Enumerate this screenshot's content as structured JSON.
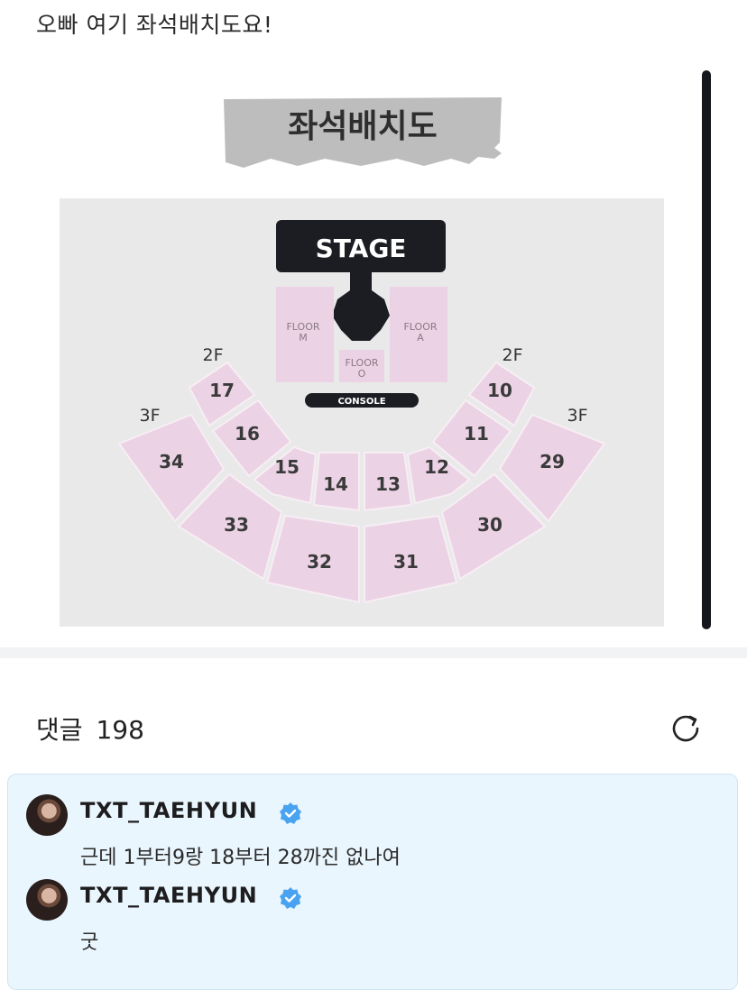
{
  "post": {
    "text": "오빠 여기 좌석배치도요!"
  },
  "seating_chart": {
    "title": "좌석배치도",
    "stage_label": "STAGE",
    "console_label": "CONSOLE",
    "floor_labels": {
      "m_line1": "FLOOR",
      "m_line2": "M",
      "a_line1": "FLOOR",
      "a_line2": "A",
      "o_line1": "FLOOR",
      "o_line2": "O"
    },
    "level_labels": [
      "2F",
      "2F",
      "3F",
      "3F"
    ],
    "sections": {
      "s17": "17",
      "s16": "16",
      "s15": "15",
      "s14": "14",
      "s13": "13",
      "s12": "12",
      "s11": "11",
      "s10": "10",
      "s34": "34",
      "s33": "33",
      "s32": "32",
      "s31": "31",
      "s30": "30",
      "s29": "29"
    },
    "colors": {
      "section": "#ebd2e4",
      "background": "#e9e9ea",
      "stage": "#1b1d23"
    }
  },
  "comments": {
    "label": "댓글",
    "count": "198",
    "items": [
      {
        "username": "TXT_TAEHYUN",
        "text": "근데 1부터9랑 18부터 28까진 없나여"
      },
      {
        "username": "TXT_TAEHYUN",
        "text": "굿"
      }
    ]
  }
}
